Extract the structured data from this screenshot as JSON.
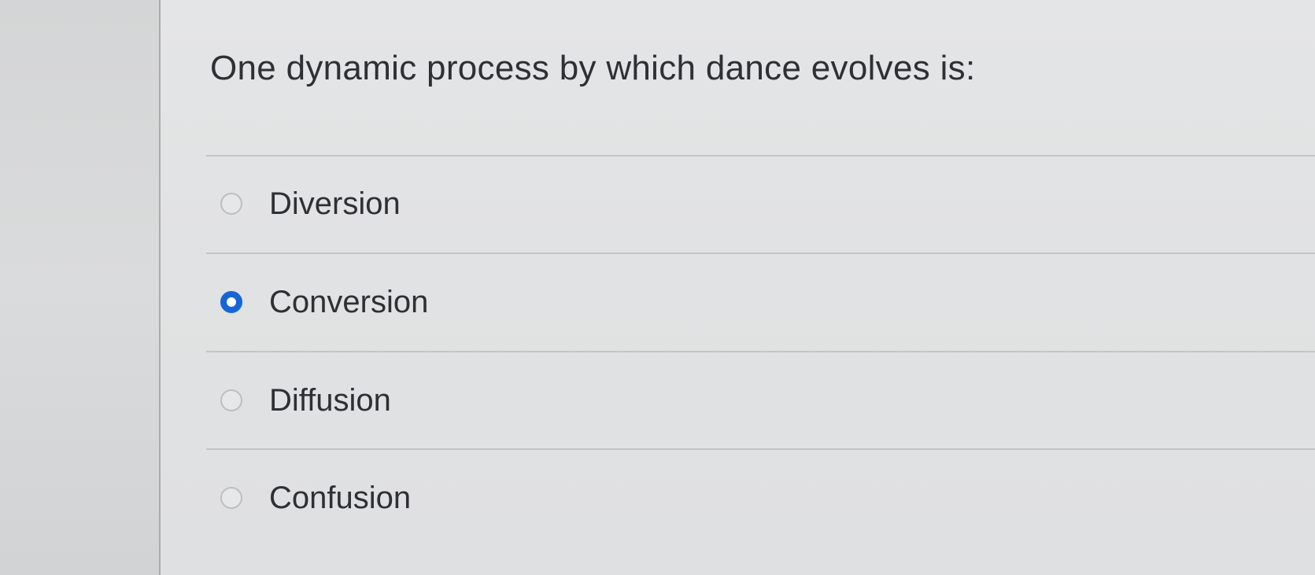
{
  "question": {
    "text": "One dynamic process by which dance evolves is:"
  },
  "options": [
    {
      "label": "Diversion",
      "selected": false
    },
    {
      "label": "Conversion",
      "selected": true
    },
    {
      "label": "Diffusion",
      "selected": false
    },
    {
      "label": "Confusion",
      "selected": false
    }
  ],
  "colors": {
    "selected_radio": "#1565d8",
    "text": "#2e3033"
  }
}
